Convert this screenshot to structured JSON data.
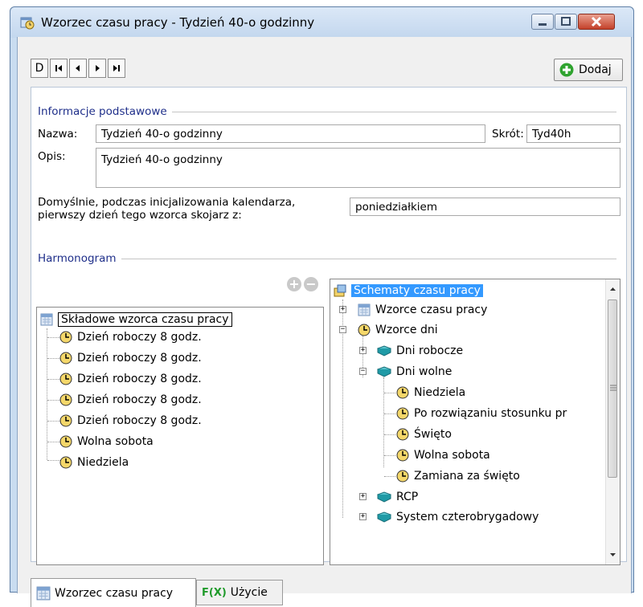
{
  "window": {
    "title": "Wzorzec czasu pracy - Tydzień 40-o godzinny",
    "icon": "calendar-clock-icon"
  },
  "toolbar": {
    "nav_buttons": [
      "D",
      "first-record-icon",
      "previous-record-icon",
      "next-record-icon",
      "last-record-icon"
    ],
    "add_label": "Dodaj"
  },
  "basic": {
    "section_title": "Informacje podstawowe",
    "name_label": "Nazwa:",
    "name_value": "Tydzień 40-o godzinny",
    "short_label": "Skrót:",
    "short_value": "Tyd40h",
    "desc_label": "Opis:",
    "desc_value": "Tydzień 40-o godzinny",
    "default_line1": "Domyślnie, podczas inicjalizowania kalendarza,",
    "default_line2": "pierwszy dzień tego wzorca skojarz z:",
    "default_value": "poniedziałkiem"
  },
  "schedule": {
    "section_title": "Harmonogram",
    "left_tree": {
      "root": "Składowe wzorca czasu pracy",
      "items": [
        "Dzień roboczy 8 godz.",
        "Dzień roboczy 8 godz.",
        "Dzień roboczy 8 godz.",
        "Dzień roboczy 8 godz.",
        "Dzień roboczy 8 godz.",
        "Wolna sobota",
        "Niedziela"
      ]
    },
    "right_tree": {
      "root": "Schematy czasu pracy",
      "patterns": "Wzorce czasu pracy",
      "day_patterns": "Wzorce dni",
      "work_days": "Dni robocze",
      "free_days": "Dni wolne",
      "free_day_items": [
        "Niedziela",
        "Po rozwiązaniu stosunku pr",
        "Święto",
        "Wolna sobota",
        "Zamiana za święto"
      ],
      "rcp": "RCP",
      "four_brigade": "System czterobrygadowy"
    }
  },
  "tabs": {
    "tab1": "Wzorzec czasu pracy",
    "tab2": "Użycie",
    "tab2_icon_text": "F(X)"
  },
  "colors": {
    "title_text": "#1f2f8a",
    "selection": "#3399ff",
    "add_icon": "#2fa32f",
    "book": "#1f9aa6"
  }
}
